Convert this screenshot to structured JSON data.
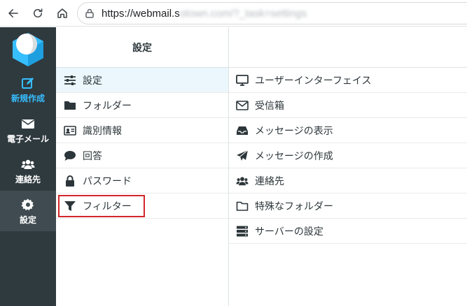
{
  "browser": {
    "url_visible": "https://webmail.s",
    "url_obscured": "otown.com/?_task=settings"
  },
  "nav": {
    "items": [
      {
        "label": "新規作成",
        "icon": "compose-icon"
      },
      {
        "label": "電子メール",
        "icon": "envelope-icon"
      },
      {
        "label": "連絡先",
        "icon": "users-icon"
      },
      {
        "label": "設定",
        "icon": "gear-icon"
      }
    ]
  },
  "settings": {
    "header": "設定",
    "items": [
      {
        "label": "設定",
        "icon": "sliders-icon"
      },
      {
        "label": "フォルダー",
        "icon": "folder-icon"
      },
      {
        "label": "識別情報",
        "icon": "id-card-icon"
      },
      {
        "label": "回答",
        "icon": "speech-bubble-icon"
      },
      {
        "label": "パスワード",
        "icon": "lock-icon"
      },
      {
        "label": "フィルター",
        "icon": "filter-icon"
      }
    ]
  },
  "preferences": {
    "items": [
      {
        "label": "ユーザーインターフェイス",
        "icon": "monitor-icon"
      },
      {
        "label": "受信箱",
        "icon": "envelope-outline-icon"
      },
      {
        "label": "メッセージの表示",
        "icon": "inbox-tray-icon"
      },
      {
        "label": "メッセージの作成",
        "icon": "paper-plane-icon"
      },
      {
        "label": "連絡先",
        "icon": "users-icon"
      },
      {
        "label": "特殊なフォルダー",
        "icon": "folder-outline-icon"
      },
      {
        "label": "サーバーの設定",
        "icon": "server-icon"
      }
    ]
  },
  "colors": {
    "accent": "#37beff",
    "nav_bg": "#2f3a3f",
    "selected_bg": "#ebf7fd",
    "highlight": "#d2262c"
  }
}
